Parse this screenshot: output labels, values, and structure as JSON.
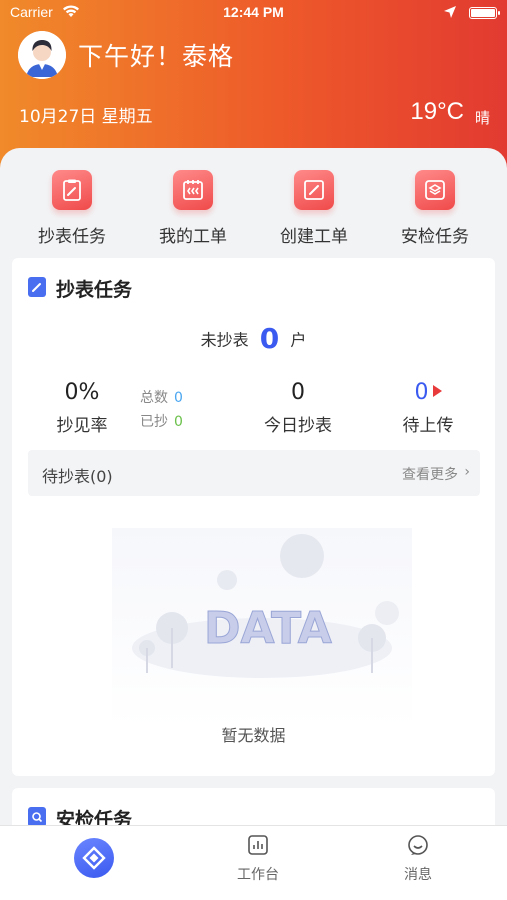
{
  "status_bar": {
    "carrier": "Carrier",
    "time": "12:44 PM"
  },
  "header": {
    "greeting": "下午好！泰格",
    "date": "10月27日 星期五",
    "temperature": "19°C",
    "weather": "晴"
  },
  "quick_actions": [
    {
      "label": "抄表任务",
      "icon": "clipboard-edit-icon"
    },
    {
      "label": "我的工单",
      "icon": "work-order-icon"
    },
    {
      "label": "创建工单",
      "icon": "create-order-icon"
    },
    {
      "label": "安检任务",
      "icon": "safety-check-icon"
    }
  ],
  "meter_card": {
    "title": "抄表任务",
    "unread_prefix": "未抄表",
    "unread_count": "0",
    "unread_suffix": "户",
    "rate_value": "0%",
    "rate_label": "抄见率",
    "total_label": "总数",
    "total_value": "0",
    "done_label": "已抄",
    "done_value": "0",
    "today_value": "0",
    "today_label": "今日抄表",
    "upload_value": "0",
    "upload_label": "待上传",
    "pending_label": "待抄表(0)",
    "more_label": "查看更多",
    "empty_image_text": "DATA",
    "empty_text": "暂无数据"
  },
  "safety_card": {
    "title": "安检任务"
  },
  "tabbar": [
    {
      "label": "",
      "icon": "home-icon"
    },
    {
      "label": "工作台",
      "icon": "workbench-icon"
    },
    {
      "label": "消息",
      "icon": "message-icon"
    }
  ],
  "colors": {
    "accent": "#3a5af0",
    "header_start": "#f08a2a",
    "header_end": "#e23a31",
    "upload_arrow": "#e83a3a"
  }
}
